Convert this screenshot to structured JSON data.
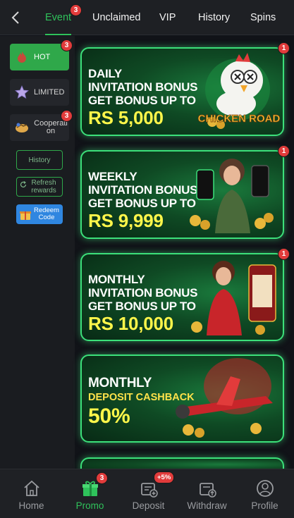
{
  "colors": {
    "accent": "#2fc25b",
    "badge": "#e23b3b",
    "banner_border": "#3ce07a",
    "highlight_yellow": "#fff64a"
  },
  "topbar": {
    "back_icon": "chevron-left-icon",
    "tabs": [
      {
        "label": "Event",
        "badge": "3",
        "active": true
      },
      {
        "label": "Unclaimed"
      },
      {
        "label": "VIP"
      },
      {
        "label": "History"
      },
      {
        "label": "Spins"
      }
    ]
  },
  "sidebar": {
    "categories": [
      {
        "label": "HOT",
        "badge": "3",
        "icon": "flame-icon",
        "active": true
      },
      {
        "label": "LIMITED",
        "icon": "star-icon"
      },
      {
        "label": "Cooperation",
        "badge": "3",
        "icon": "handshake-icon"
      }
    ],
    "history_label": "History",
    "refresh_label": "Refresh rewards",
    "redeem_label": "Redeem Code"
  },
  "banners": [
    {
      "line1": "DAILY",
      "line2": "INVITATION BONUS",
      "line3": "GET BONUS UP TO",
      "amount": "RS 5,000",
      "badge": "1",
      "art_text": "CHICKEN ROAD"
    },
    {
      "line1": "WEEKLY",
      "line2": "INVITATION BONUS",
      "line3": "GET BONUS UP TO",
      "amount": "RS 9,999",
      "badge": "1"
    },
    {
      "line1": "MONTHLY",
      "line2": "INVITATION BONUS",
      "line3": "GET BONUS UP TO",
      "amount": "RS 10,000",
      "badge": "1"
    },
    {
      "line1": "MONTHLY",
      "line2": "DEPOSIT CASHBACK",
      "amount": "50%"
    }
  ],
  "bottomnav": {
    "items": [
      {
        "label": "Home",
        "icon": "home-icon"
      },
      {
        "label": "Promo",
        "icon": "gift-icon",
        "badge": "3",
        "active": true
      },
      {
        "label": "Deposit",
        "icon": "wallet-plus-icon",
        "badge": "+5%"
      },
      {
        "label": "Withdraw",
        "icon": "wallet-up-icon"
      },
      {
        "label": "Profile",
        "icon": "person-icon"
      }
    ]
  }
}
